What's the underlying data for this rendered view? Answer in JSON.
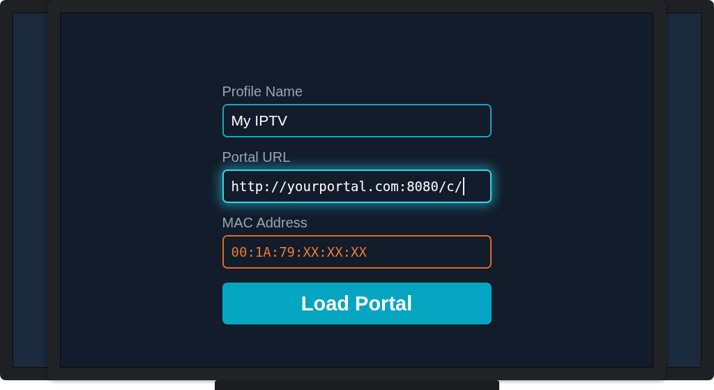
{
  "form": {
    "fields": [
      {
        "label": "Profile Name",
        "value": "My IPTV",
        "focused": false,
        "error": false,
        "monospace": false
      },
      {
        "label": "Portal URL",
        "value": "http://yourportal.com:8080/c/",
        "focused": true,
        "error": false,
        "monospace": true
      },
      {
        "label": "MAC Address",
        "value": "00:1A:79:XX:XX:XX",
        "focused": false,
        "error": true,
        "monospace": true
      }
    ],
    "button": {
      "label": "Load Portal"
    }
  }
}
